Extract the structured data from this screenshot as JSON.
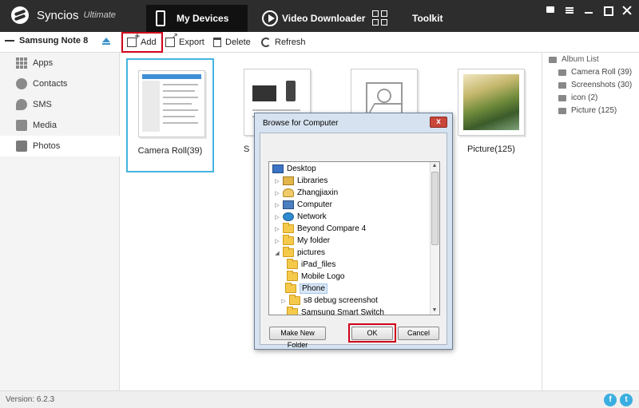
{
  "app": {
    "name": "Syncios",
    "edition": "Ultimate",
    "nav_tabs": [
      {
        "label": "My Devices",
        "icon": "phone-icon",
        "active": true
      },
      {
        "label": "Video Downloader",
        "icon": "play-icon",
        "active": false
      },
      {
        "label": "Toolkit",
        "icon": "grid-icon",
        "active": false
      }
    ],
    "window_controls": [
      "message-icon",
      "menu-icon",
      "minimize-icon",
      "maximize-icon",
      "close-icon"
    ]
  },
  "toolbar": {
    "device_name": "Samsung Note 8",
    "add_label": "Add",
    "export_label": "Export",
    "delete_label": "Delete",
    "refresh_label": "Refresh"
  },
  "sidebar": {
    "items": [
      {
        "label": "Apps",
        "icon": "apps-icon"
      },
      {
        "label": "Contacts",
        "icon": "contacts-icon"
      },
      {
        "label": "SMS",
        "icon": "sms-icon"
      },
      {
        "label": "Media",
        "icon": "media-icon"
      },
      {
        "label": "Photos",
        "icon": "photos-icon",
        "active": true
      }
    ]
  },
  "albums": [
    {
      "label": "Camera Roll(39)",
      "selected": true
    },
    {
      "label": "S",
      "selected": false
    },
    {
      "label": "",
      "selected": false
    },
    {
      "label": "Picture(125)",
      "selected": false
    }
  ],
  "album_list": {
    "header": "Album List",
    "items": [
      {
        "label": "Camera Roll (39)",
        "icon": "camera-icon"
      },
      {
        "label": "Screenshots (30)",
        "icon": "image-icon"
      },
      {
        "label": "icon (2)",
        "icon": "image-icon"
      },
      {
        "label": "Picture (125)",
        "icon": "image-icon"
      }
    ]
  },
  "footer": {
    "version": "Version: 6.2.3",
    "facebook_glyph": "f",
    "twitter_glyph": "t"
  },
  "dialog": {
    "title": "Browse for Computer",
    "close_glyph": "x",
    "tree": [
      {
        "label": "Desktop",
        "icon": "desktop-icon",
        "expander": ""
      },
      {
        "label": "Libraries",
        "icon": "libraries-icon",
        "expander": "▷"
      },
      {
        "label": "Zhangjiaxin",
        "icon": "user-folder-icon",
        "expander": "▷"
      },
      {
        "label": "Computer",
        "icon": "computer-icon",
        "expander": "▷"
      },
      {
        "label": "Network",
        "icon": "network-icon",
        "expander": "▷"
      },
      {
        "label": "Beyond Compare 4",
        "icon": "folder-icon",
        "expander": "▷"
      },
      {
        "label": "My folder",
        "icon": "folder-icon",
        "expander": "▷"
      },
      {
        "label": "pictures",
        "icon": "folder-icon",
        "expander": "◢"
      },
      {
        "label": "iPad_files",
        "icon": "folder-icon",
        "expander": ""
      },
      {
        "label": "Mobile Logo",
        "icon": "folder-icon",
        "expander": ""
      },
      {
        "label": "Phone",
        "icon": "folder-icon",
        "expander": "",
        "selected": true
      },
      {
        "label": "s8 debug screenshot",
        "icon": "folder-icon",
        "expander": "▷"
      },
      {
        "label": "Samsung Smart Switch",
        "icon": "folder-icon",
        "expander": ""
      }
    ],
    "make_new_folder_label": "Make New Folder",
    "ok_label": "OK",
    "cancel_label": "Cancel"
  }
}
